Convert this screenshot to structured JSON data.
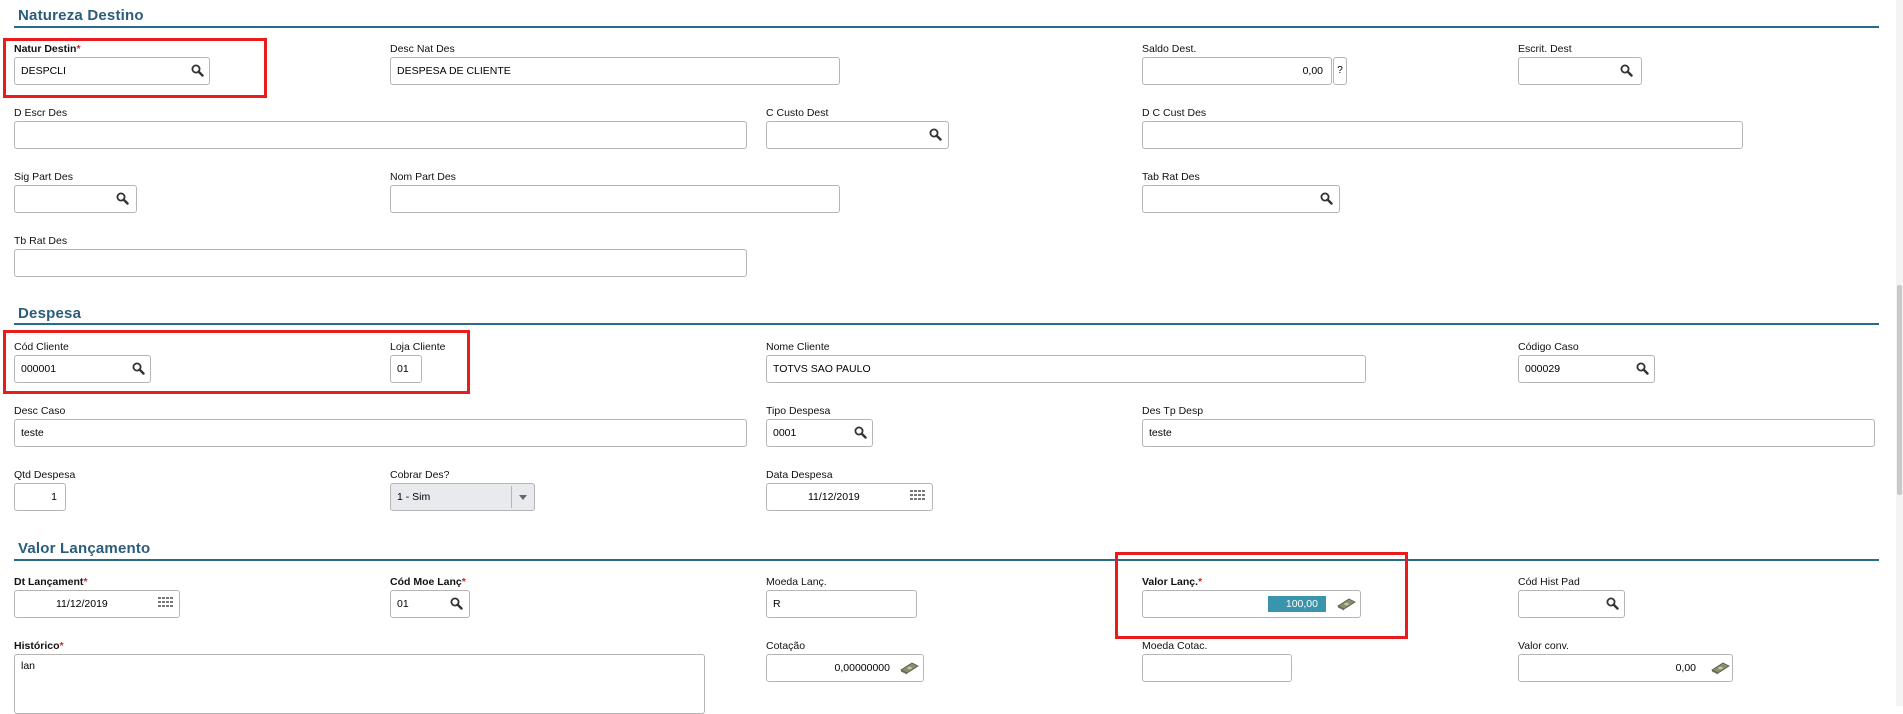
{
  "sections": {
    "natureza": "Natureza Destino",
    "despesa": "Despesa",
    "valor": "Valor Lançamento"
  },
  "natureza": {
    "natur_destin": {
      "label": "Natur Destin",
      "value": "DESPCLI"
    },
    "desc_nat_des": {
      "label": "Desc Nat Des",
      "value": "DESPESA  DE CLIENTE"
    },
    "saldo_dest": {
      "label": "Saldo Dest.",
      "value": "0,00",
      "help": "?"
    },
    "escrit_dest": {
      "label": "Escrit. Dest",
      "value": ""
    },
    "d_escr_des": {
      "label": "D Escr Des",
      "value": ""
    },
    "c_custo_dest": {
      "label": "C Custo Dest",
      "value": ""
    },
    "d_c_cust_des": {
      "label": "D C Cust Des",
      "value": ""
    },
    "sig_part_des": {
      "label": "Sig Part Des",
      "value": ""
    },
    "nom_part_des": {
      "label": "Nom Part Des",
      "value": ""
    },
    "tab_rat_des": {
      "label": "Tab Rat Des",
      "value": ""
    },
    "tb_rat_des": {
      "label": "Tb Rat Des",
      "value": ""
    }
  },
  "despesa": {
    "cod_cliente": {
      "label": "Cód Cliente",
      "value": "000001"
    },
    "loja_cliente": {
      "label": "Loja Cliente",
      "value": "01"
    },
    "nome_cliente": {
      "label": "Nome Cliente",
      "value": "TOTVS SAO PAULO"
    },
    "codigo_caso": {
      "label": "Código Caso",
      "value": "000029"
    },
    "desc_caso": {
      "label": "Desc Caso",
      "value": "teste"
    },
    "tipo_despesa": {
      "label": "Tipo Despesa",
      "value": "0001"
    },
    "des_tp_desp": {
      "label": "Des Tp Desp",
      "value": "teste"
    },
    "qtd_despesa": {
      "label": "Qtd Despesa",
      "value": "1"
    },
    "cobrar_des": {
      "label": "Cobrar Des?",
      "value": "1 - Sim"
    },
    "data_despesa": {
      "label": "Data Despesa",
      "value": "11/12/2019"
    }
  },
  "valor": {
    "dt_lancament": {
      "label": "Dt Lançament",
      "value": "11/12/2019"
    },
    "cod_moe_lanc": {
      "label": "Cód Moe Lanç",
      "value": "01"
    },
    "moeda_lanc": {
      "label": "Moeda  Lanç.",
      "value": "R"
    },
    "valor_lanc": {
      "label": "Valor Lanç.",
      "value": "100,00"
    },
    "cod_hist_pad": {
      "label": "Cód Hist Pad",
      "value": ""
    },
    "historico": {
      "label": "Histórico",
      "value": "lan"
    },
    "cotacao": {
      "label": "Cotação",
      "value": "0,00000000"
    },
    "moeda_cotac": {
      "label": "Moeda Cotac.",
      "value": ""
    },
    "valor_conv": {
      "label": "Valor conv.",
      "value": "0,00"
    }
  },
  "required_mark": "*",
  "icons": [
    "search-icon",
    "calendar-icon",
    "money-icon",
    "dropdown-arrow-icon"
  ],
  "colors": {
    "section_title": "#2a5d7a",
    "highlight_box": "#e81c1c",
    "selected_value_bg": "#3a95ac"
  }
}
